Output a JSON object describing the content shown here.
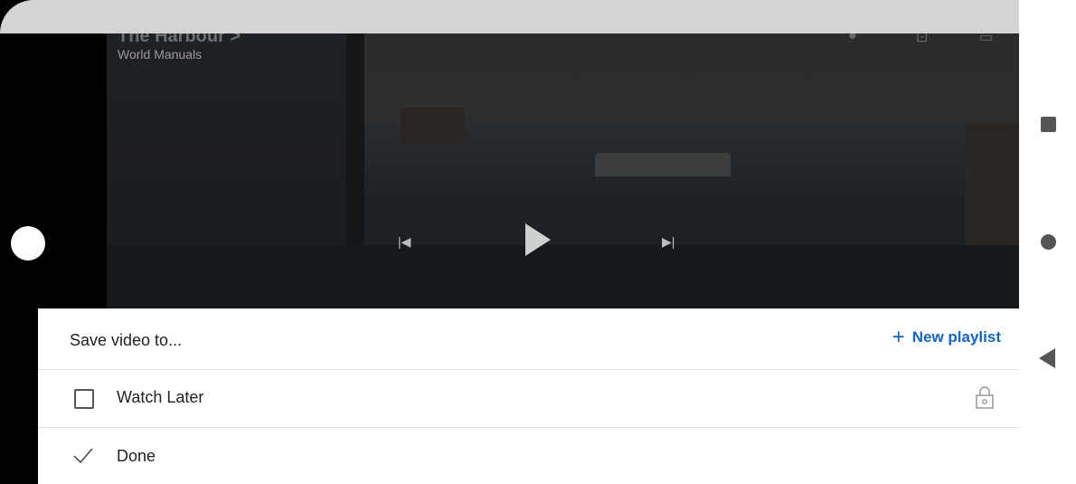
{
  "video": {
    "title": "The Harbour >",
    "channel": "World Manuals"
  },
  "sheet": {
    "title": "Save video to...",
    "new_playlist_label": "New playlist",
    "items": [
      {
        "label": "Watch Later",
        "checked": false,
        "private": true
      }
    ],
    "done_label": "Done"
  },
  "icons": {
    "plus": "+",
    "prev": "|◀",
    "next": "▶|"
  },
  "colors": {
    "accent": "#1565c0"
  }
}
